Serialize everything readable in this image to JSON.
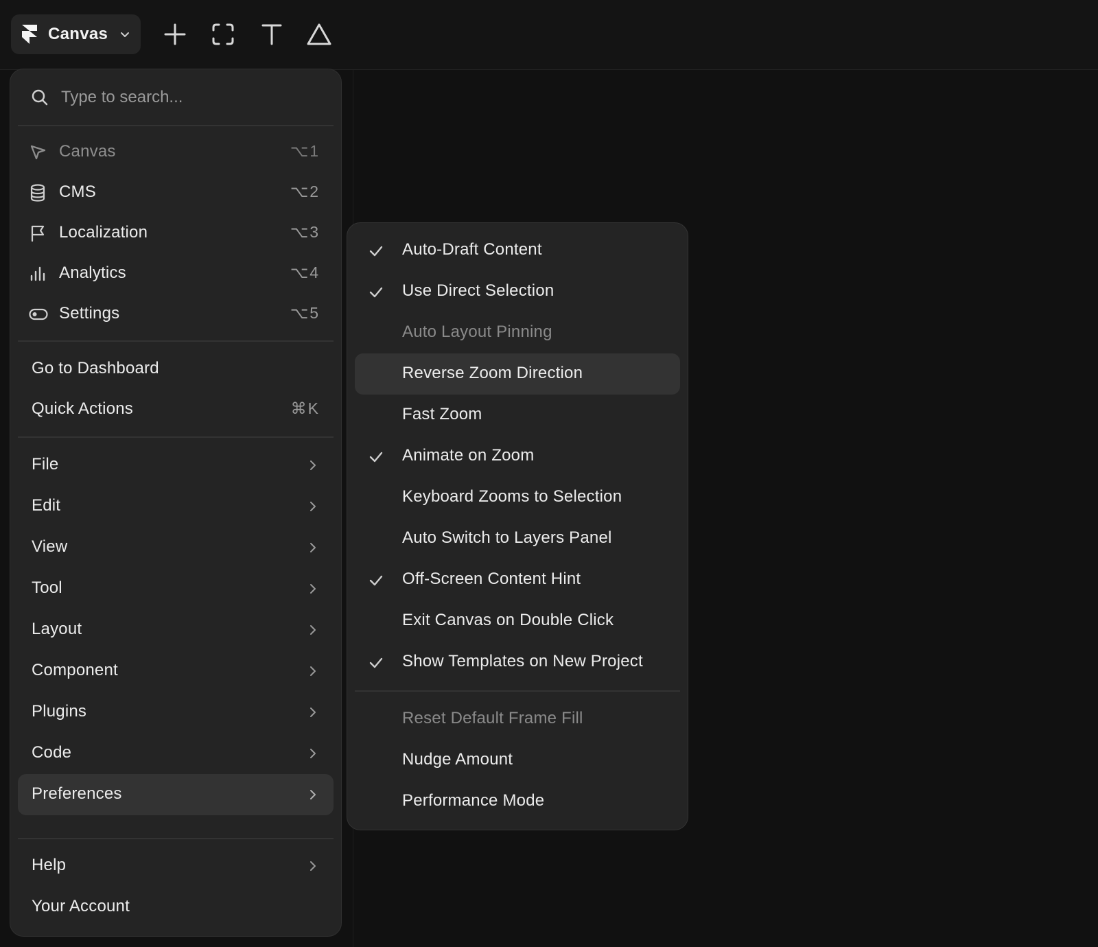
{
  "toolbar": {
    "app_button_label": "Canvas",
    "tools": [
      "insert-tool",
      "frame-tool",
      "text-tool",
      "shape-tool"
    ]
  },
  "menu": {
    "search_placeholder": "Type to search...",
    "workspaces": [
      {
        "label": "Canvas",
        "shortcut": "⌥1",
        "icon": "cursor-icon",
        "dim": true
      },
      {
        "label": "CMS",
        "shortcut": "⌥2",
        "icon": "database-icon"
      },
      {
        "label": "Localization",
        "shortcut": "⌥3",
        "icon": "flag-icon"
      },
      {
        "label": "Analytics",
        "shortcut": "⌥4",
        "icon": "bar-chart-icon"
      },
      {
        "label": "Settings",
        "shortcut": "⌥5",
        "icon": "toggle-icon"
      }
    ],
    "go_to_dashboard": "Go to Dashboard",
    "quick_actions": {
      "label": "Quick Actions",
      "shortcut": "⌘K"
    },
    "submenus": [
      "File",
      "Edit",
      "View",
      "Tool",
      "Layout",
      "Component",
      "Plugins",
      "Code",
      "Preferences"
    ],
    "help": "Help",
    "your_account": "Your Account",
    "selected": "Preferences"
  },
  "preferences_submenu": {
    "items": [
      {
        "label": "Auto-Draft Content",
        "checked": true
      },
      {
        "label": "Use Direct Selection",
        "checked": true
      },
      {
        "label": "Auto Layout Pinning",
        "checked": false,
        "disabled": true
      },
      {
        "label": "Reverse Zoom Direction",
        "checked": false,
        "hovered": true
      },
      {
        "label": "Fast Zoom",
        "checked": false
      },
      {
        "label": "Animate on Zoom",
        "checked": true
      },
      {
        "label": "Keyboard Zooms to Selection",
        "checked": false
      },
      {
        "label": "Auto Switch to Layers Panel",
        "checked": false
      },
      {
        "label": "Off-Screen Content Hint",
        "checked": true
      },
      {
        "label": "Exit Canvas on Double Click",
        "checked": false
      },
      {
        "label": "Show Templates on New Project",
        "checked": true
      }
    ],
    "extra": [
      {
        "label": "Reset Default Frame Fill",
        "disabled": true
      },
      {
        "label": "Nudge Amount"
      },
      {
        "label": "Performance Mode"
      }
    ]
  }
}
